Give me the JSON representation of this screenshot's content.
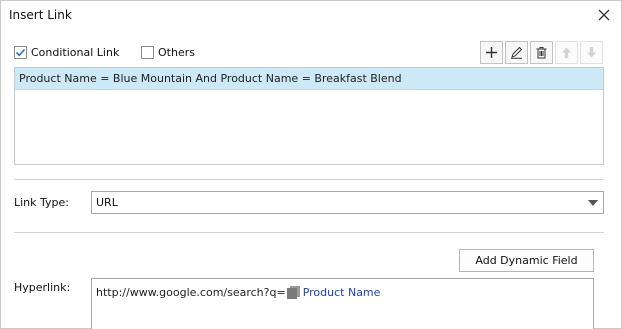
{
  "dialog": {
    "title": "Insert Link"
  },
  "conditional_link": {
    "label": "Conditional Link",
    "checked": true
  },
  "others": {
    "label": "Others",
    "checked": false
  },
  "toolbar": {
    "icons": [
      "plus-icon",
      "pencil-icon",
      "trash-icon",
      "arrow-up-icon",
      "arrow-down-icon"
    ]
  },
  "conditions": {
    "items": [
      "Product Name = Blue Mountain And Product Name = Breakfast Blend"
    ]
  },
  "link_type": {
    "label": "Link Type:",
    "value": "URL"
  },
  "add_dynamic_field": {
    "label": "Add Dynamic Field"
  },
  "hyperlink": {
    "label": "Hyperlink:",
    "static_text": "http://www.google.com/search?q=",
    "field_name": "Product Name"
  },
  "colors": {
    "selected_row": "#cde8f7",
    "check": "#2a6fc9",
    "field_text": "#1c3fc0"
  }
}
